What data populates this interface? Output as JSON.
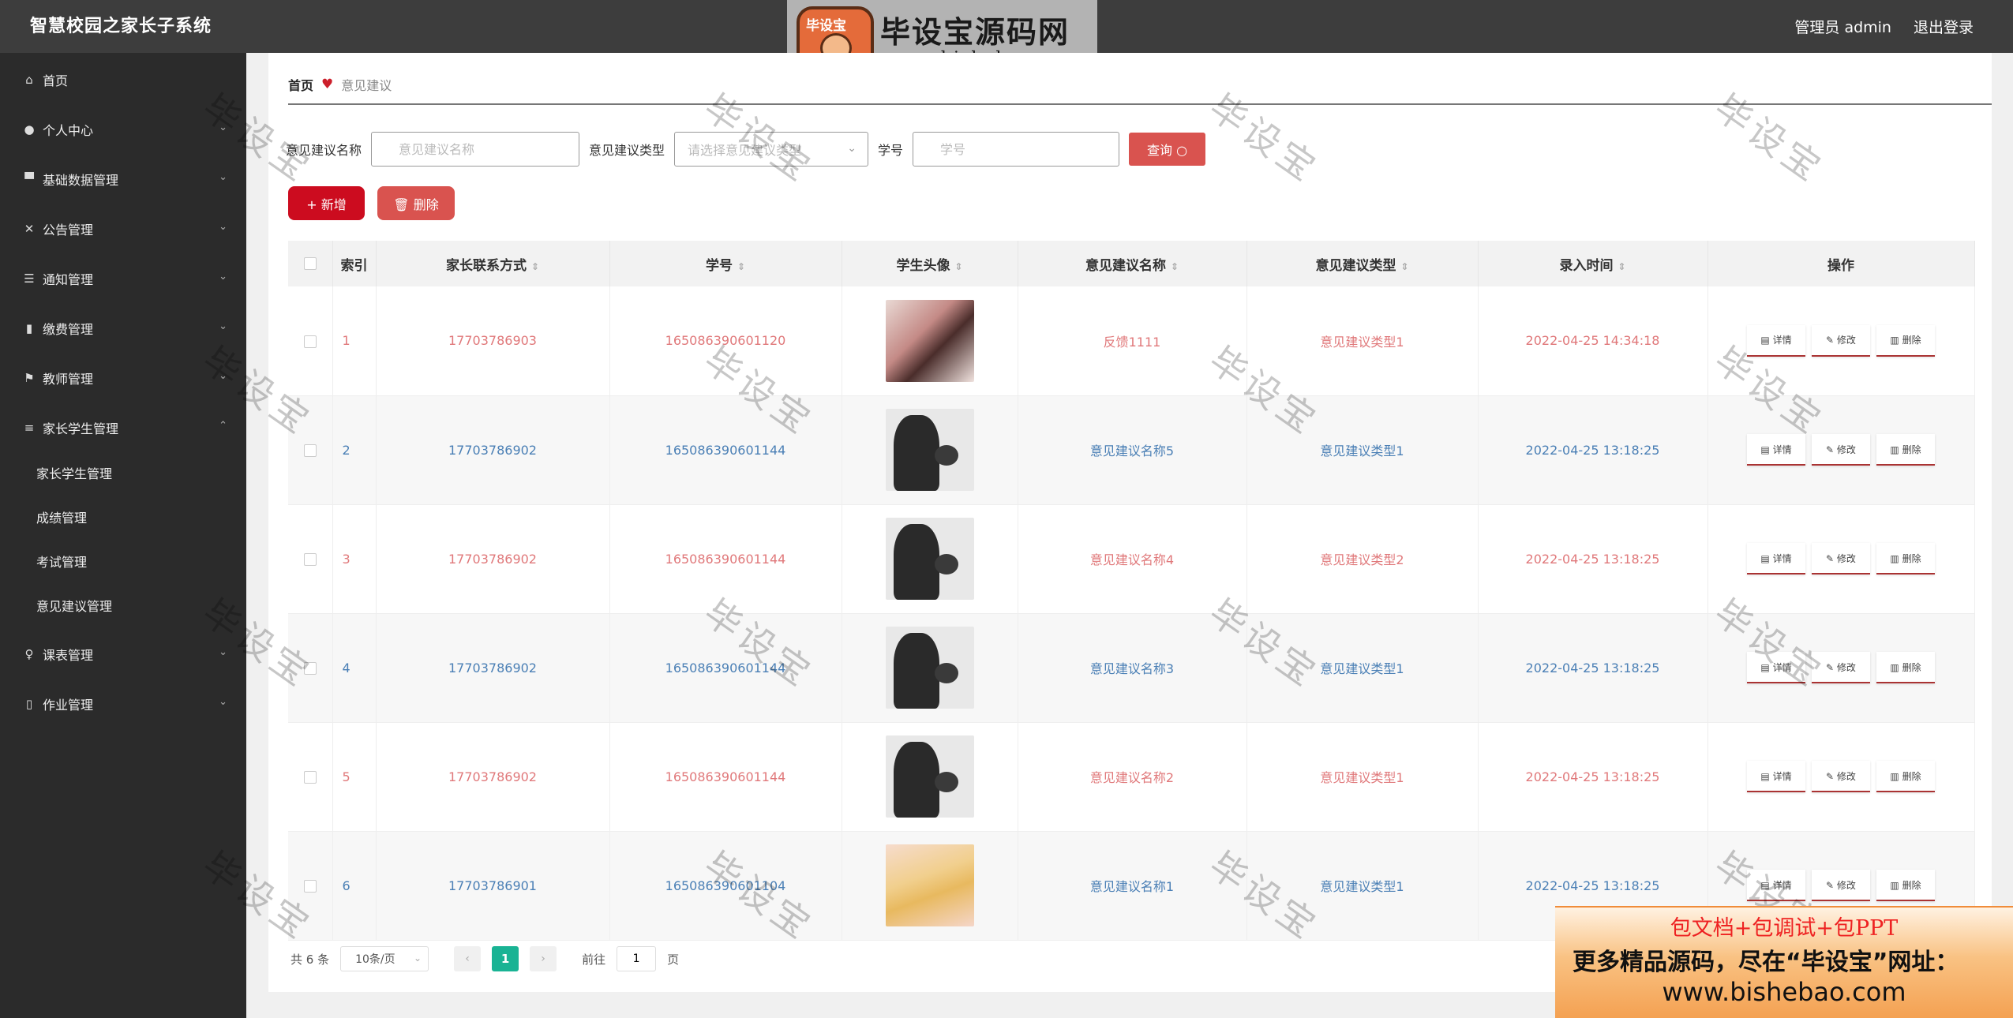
{
  "app": {
    "title": "智慧校园之家长子系统"
  },
  "header": {
    "user_label": "管理员 admin",
    "logout_label": "退出登录"
  },
  "watermark": {
    "logo_badge": "毕设宝",
    "logo_text": "毕设宝源码网",
    "logo_url": "www.bishebao.com",
    "diagonal": "毕设宝"
  },
  "sidebar": {
    "items": [
      {
        "label": "首页",
        "icon": "home-icon"
      },
      {
        "label": "个人中心",
        "icon": "user-icon"
      },
      {
        "label": "基础数据管理",
        "icon": "database-icon"
      },
      {
        "label": "公告管理",
        "icon": "announcement-icon"
      },
      {
        "label": "通知管理",
        "icon": "sliders-icon"
      },
      {
        "label": "缴费管理",
        "icon": "bar-chart-icon"
      },
      {
        "label": "教师管理",
        "icon": "flag-icon"
      },
      {
        "label": "家长学生管理",
        "icon": "list-icon"
      }
    ],
    "subitems": [
      {
        "label": "家长学生管理"
      },
      {
        "label": "成绩管理"
      },
      {
        "label": "考试管理"
      },
      {
        "label": "意见建议管理"
      }
    ],
    "items_after": [
      {
        "label": "课表管理",
        "icon": "microphone-icon"
      },
      {
        "label": "作业管理",
        "icon": "phone-icon"
      }
    ]
  },
  "breadcrumb": {
    "home": "首页",
    "current": "意见建议"
  },
  "search": {
    "name_label": "意见建议名称",
    "name_placeholder": "意见建议名称",
    "type_label": "意见建议类型",
    "type_placeholder": "请选择意见建议类型",
    "student_label": "学号",
    "student_placeholder": "学号",
    "query_label": "查询"
  },
  "actions": {
    "add_label": "新增",
    "delete_label": "删除"
  },
  "table": {
    "headers": {
      "index": "索引",
      "contact": "家长联系方式",
      "student_no": "学号",
      "avatar": "学生头像",
      "name": "意见建议名称",
      "type": "意见建议类型",
      "time": "录入时间",
      "ops": "操作"
    },
    "op_labels": {
      "detail": "详情",
      "edit": "修改",
      "delete": "删除"
    },
    "rows": [
      {
        "index": "1",
        "contact": "17703786903",
        "student_no": "165086390601120",
        "name": "反馈1111",
        "type": "意见建议类型1",
        "time": "2022-04-25 14:34:18"
      },
      {
        "index": "2",
        "contact": "17703786902",
        "student_no": "165086390601144",
        "name": "意见建议名称5",
        "type": "意见建议类型1",
        "time": "2022-04-25 13:18:25"
      },
      {
        "index": "3",
        "contact": "17703786902",
        "student_no": "165086390601144",
        "name": "意见建议名称4",
        "type": "意见建议类型2",
        "time": "2022-04-25 13:18:25"
      },
      {
        "index": "4",
        "contact": "17703786902",
        "student_no": "165086390601144",
        "name": "意见建议名称3",
        "type": "意见建议类型1",
        "time": "2022-04-25 13:18:25"
      },
      {
        "index": "5",
        "contact": "17703786902",
        "student_no": "165086390601144",
        "name": "意见建议名称2",
        "type": "意见建议类型1",
        "time": "2022-04-25 13:18:25"
      },
      {
        "index": "6",
        "contact": "17703786901",
        "student_no": "165086390601104",
        "name": "意见建议名称1",
        "type": "意见建议类型1",
        "time": "2022-04-25 13:18:25"
      }
    ]
  },
  "pagination": {
    "total": "共 6 条",
    "page_size": "10条/页",
    "current_page": "1",
    "jump_label": "前往",
    "jump_value": "1",
    "page_unit": "页"
  },
  "ad": {
    "line1": "包文档+包调试+包PPT",
    "line2": "更多精品源码，尽在“毕设宝”网址：",
    "line3": "www.bishebao.com"
  },
  "colors": {
    "topbar": "#3d3d3d",
    "sidebar": "#2b2b2b",
    "primary_red": "#cc0c1f",
    "query_red": "#d9534f",
    "odd_text": "#e0787a",
    "even_text": "#4a7fb5",
    "page_active": "#19b394"
  }
}
